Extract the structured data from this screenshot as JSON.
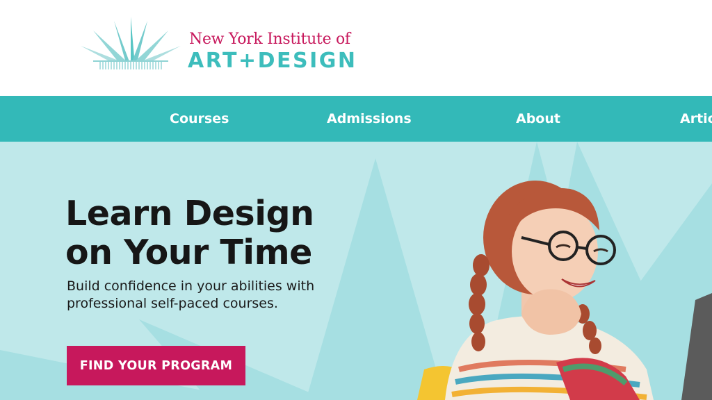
{
  "colors": {
    "brand_magenta": "#c7185c",
    "brand_teal": "#3dbdbc",
    "nav_bg": "#33b9b8",
    "hero_bg": "#bfe8ea",
    "hero_ray": "#a6dfe2",
    "heading_text": "#161616"
  },
  "logo": {
    "line1": "New York Institute of",
    "line2": "ART+DESIGN",
    "mark_icon": "crown-rays-icon"
  },
  "nav": {
    "items": [
      {
        "label": "Courses"
      },
      {
        "label": "Admissions"
      },
      {
        "label": "About"
      },
      {
        "label": "Artic"
      }
    ]
  },
  "hero": {
    "title_line1": "Learn Design",
    "title_line2": "on Your Time",
    "subtitle_line1": "Build confidence in your abilities with",
    "subtitle_line2": "professional self-paced courses.",
    "cta_label": "FIND YOUR PROGRAM",
    "photo": "smiling-woman-with-glasses-photo"
  }
}
